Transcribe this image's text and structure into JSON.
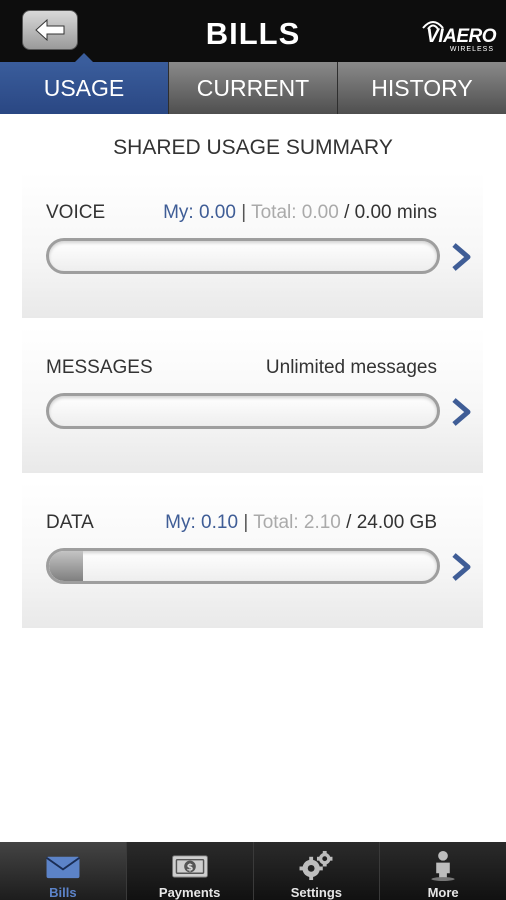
{
  "header": {
    "title": "BILLS",
    "logo_brand": "VIAERO",
    "logo_sub": "WIRELESS"
  },
  "tabs": [
    {
      "label": "USAGE",
      "active": true
    },
    {
      "label": "CURRENT",
      "active": false
    },
    {
      "label": "HISTORY",
      "active": false
    }
  ],
  "summary_title": "SHARED USAGE SUMMARY",
  "usage": {
    "voice": {
      "label": "VOICE",
      "my": "My: 0.00",
      "sep": "|",
      "total": "Total: 0.00",
      "cap": "/ 0.00 mins",
      "fill_percent": 0
    },
    "messages": {
      "label": "MESSAGES",
      "text": "Unlimited messages",
      "fill_percent": 0
    },
    "data": {
      "label": "DATA",
      "my": "My: 0.10",
      "sep": "|",
      "total": "Total: 2.10",
      "cap": "/ 24.00 GB",
      "fill_percent": 8.75
    }
  },
  "bottom_nav": [
    {
      "label": "Bills",
      "icon": "envelope-icon",
      "active": true
    },
    {
      "label": "Payments",
      "icon": "dollar-bill-icon",
      "active": false
    },
    {
      "label": "Settings",
      "icon": "gears-icon",
      "active": false
    },
    {
      "label": "More",
      "icon": "person-icon",
      "active": false
    }
  ],
  "colors": {
    "accent": "#2f4f8e",
    "my_value": "#3f5d96",
    "total_value": "#aaaaaa",
    "header_bg": "#0d0d0d"
  }
}
